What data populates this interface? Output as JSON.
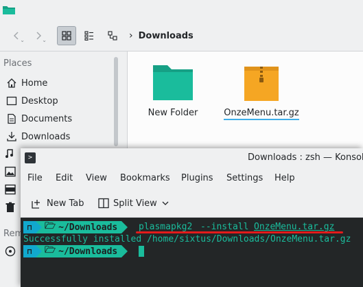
{
  "dolphin": {
    "breadcrumb": "Downloads",
    "places_header": "Places",
    "places": [
      {
        "label": "Home",
        "icon": "home-icon"
      },
      {
        "label": "Desktop",
        "icon": "desktop-icon"
      },
      {
        "label": "Documents",
        "icon": "documents-icon"
      },
      {
        "label": "Downloads",
        "icon": "downloads-icon"
      }
    ],
    "remote_header_partial": "Rem",
    "files": [
      {
        "name": "New Folder",
        "icon": "folder-icon"
      },
      {
        "name": "OnzeMenu.tar.gz",
        "icon": "archive-icon"
      }
    ]
  },
  "konsole": {
    "title": "Downloads : zsh — Konsole",
    "menu": [
      "File",
      "Edit",
      "View",
      "Bookmarks",
      "Plugins",
      "Settings",
      "Help"
    ],
    "toolbar": {
      "new_tab": "New Tab",
      "split_view": "Split View"
    },
    "terminal": {
      "prompt_dir": "~/Downloads",
      "command_name": "plasmapkg2",
      "command_flag": "--install",
      "command_arg": "OnzeMenu.tar.gz",
      "output": "Successfully installed /home/sixtus/Downloads/OnzeMenu.tar.gz"
    }
  },
  "colors": {
    "accent": "#3daee9",
    "folder_teal": "#1abc9c",
    "archive_orange": "#f5a623",
    "terminal_bg": "#232627",
    "prompt_cyan": "#11a8cd",
    "highlight_red": "#e31b1b"
  }
}
